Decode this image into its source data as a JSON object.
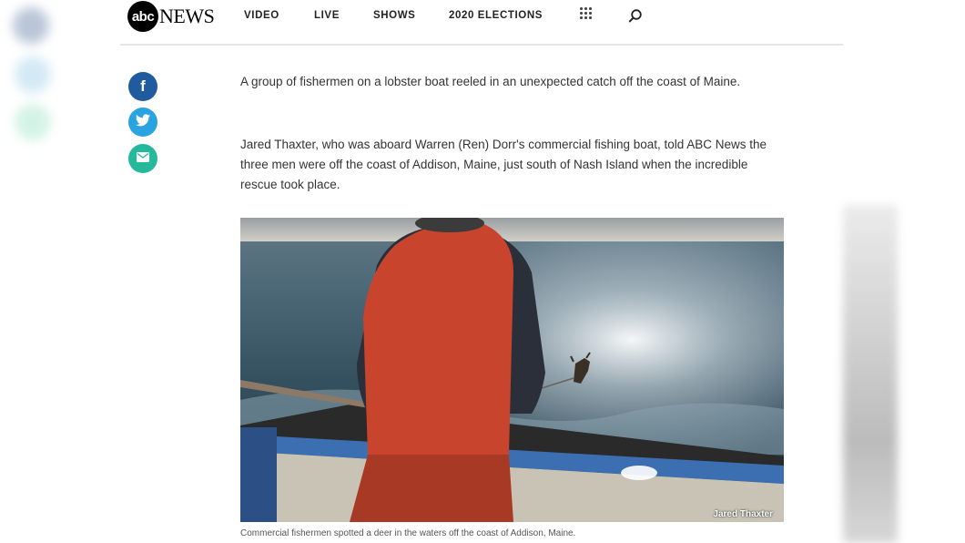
{
  "brand": {
    "logo_mark": "abc",
    "logo_word": "NEWS"
  },
  "nav": {
    "items": [
      {
        "label": "VIDEO"
      },
      {
        "label": "LIVE"
      },
      {
        "label": "SHOWS"
      },
      {
        "label": "2020 ELECTIONS"
      }
    ],
    "menu_icon": "grid-icon",
    "search_icon": "search-icon"
  },
  "share": {
    "facebook_glyph": "f",
    "twitter_icon": "twitter-bird-icon",
    "email_icon": "email-icon"
  },
  "article": {
    "paragraphs": [
      "A group of fishermen on a lobster boat reeled in an unexpected catch off the coast of Maine.",
      "Jared Thaxter, who was aboard Warren (Ren) Dorr's commercial fishing boat, told ABC News the three men were off the coast of Addison, Maine, just south of Nash Island when the incredible rescue took place."
    ],
    "photo": {
      "credit": "Jared Thaxter",
      "caption": "Commercial fishermen spotted a deer in the waters off the coast of Addison, Maine."
    }
  },
  "colors": {
    "facebook": "#1f5b9e",
    "twitter": "#2ba3e0",
    "email": "#26b89a",
    "jacket": "#c8442c"
  }
}
